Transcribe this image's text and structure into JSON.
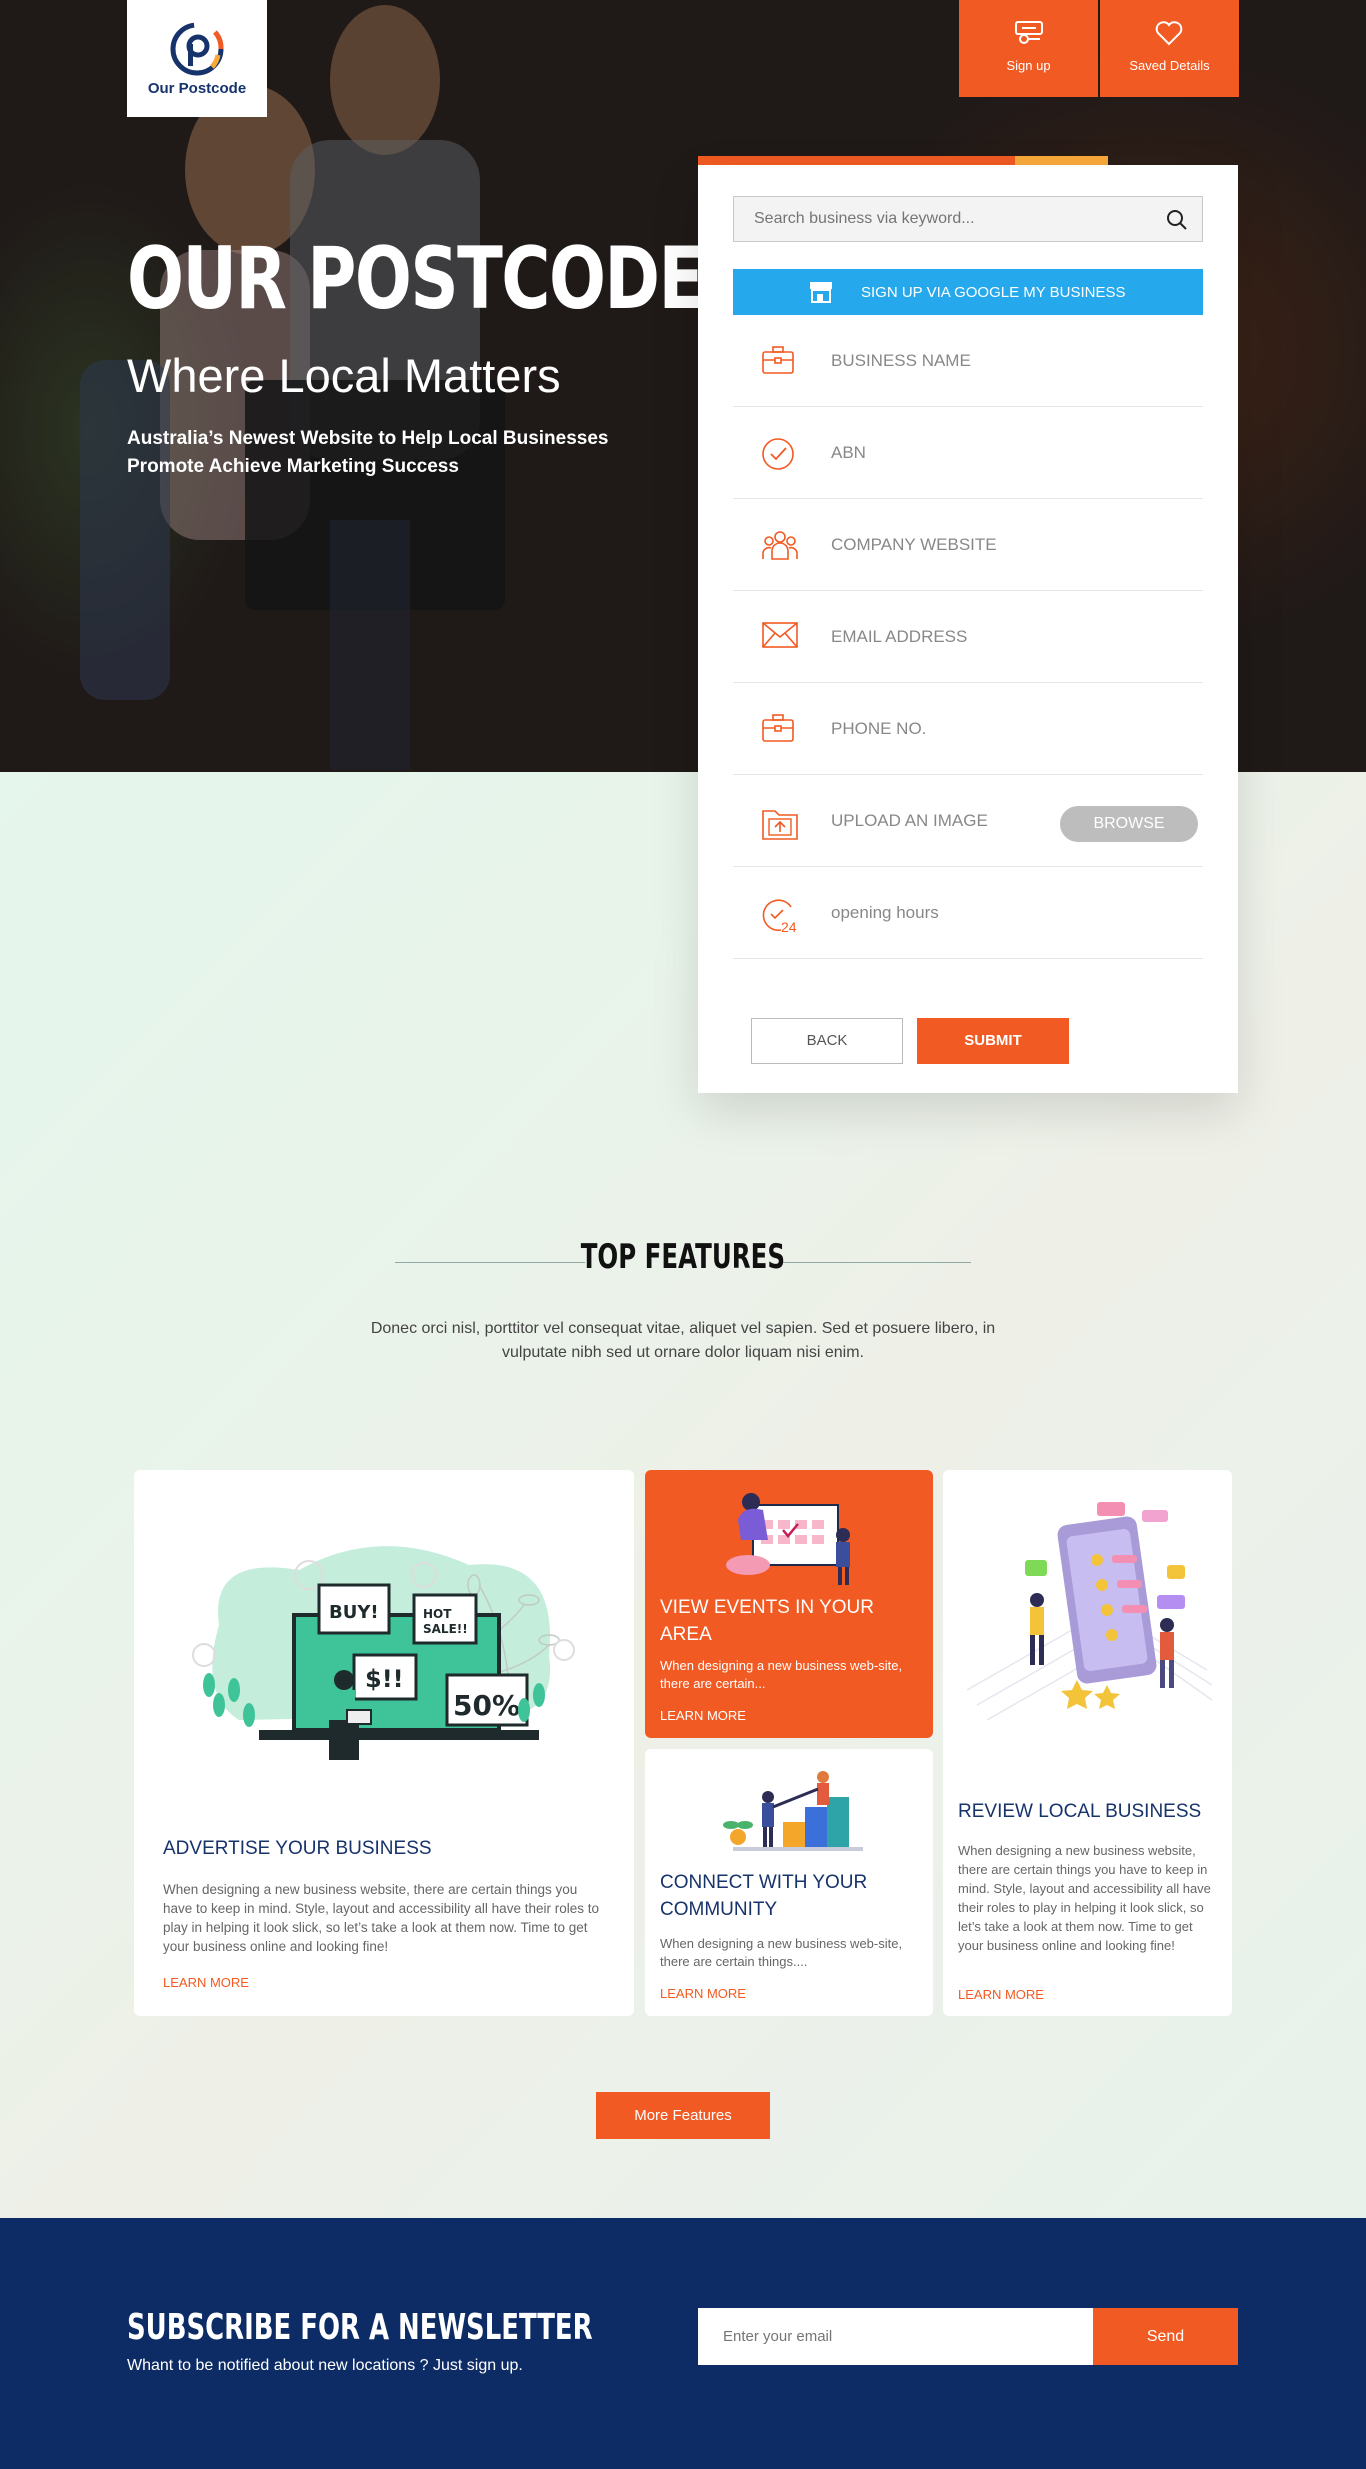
{
  "brand": {
    "logo_text": "Our Postcode"
  },
  "top_nav": {
    "signup_label": "Sign up",
    "saved_label": "Saved Details"
  },
  "hero": {
    "title": "OUR POSTCODE",
    "subtitle": "Where Local Matters",
    "description": "Australia’s Newest Website to Help Local Businesses Promote Achieve Marketing Success"
  },
  "form": {
    "search_placeholder": "Search business via keyword...",
    "google_label": "SIGN UP VIA GOOGLE MY BUSINESS",
    "fields": [
      {
        "label": "BUSINESS NAME",
        "icon": "briefcase-icon"
      },
      {
        "label": "ABN",
        "icon": "check-circle-icon"
      },
      {
        "label": "COMPANY WEBSITE",
        "icon": "team-icon"
      },
      {
        "label": "EMAIL ADDRESS",
        "icon": "envelope-icon"
      },
      {
        "label": "PHONE NO.",
        "icon": "briefcase-icon"
      },
      {
        "label": "UPLOAD AN IMAGE",
        "icon": "upload-folder-icon"
      },
      {
        "label": "opening hours",
        "icon": "clock-24-icon"
      }
    ],
    "browse_label": "BROWSE",
    "back_label": "BACK",
    "submit_label": "SUBMIT"
  },
  "features": {
    "title": "TOP FEATURES",
    "description": "Donec orci nisl, porttitor vel consequat vitae, aliquet vel sapien. Sed et posuere libero, in vulputate nibh sed ut ornare dolor liquam nisi enim.",
    "cards": [
      {
        "title": "ADVERTISE YOUR BUSINESS",
        "text": "When designing a new business website, there are certain things you have to keep in mind. Style, layout and accessibility all have their roles to play in helping it look slick, so let’s take a look at them now. Time to get your business online and looking fine!",
        "link": "LEARN MORE"
      },
      {
        "title": "VIEW EVENTS IN YOUR AREA",
        "text": "When designing a new business web-site, there are certain...",
        "link": "LEARN MORE"
      },
      {
        "title": "CONNECT WITH YOUR COMMUNITY",
        "text": "When designing a new business web-site, there are certain things....",
        "link": "LEARN MORE"
      },
      {
        "title": "REVIEW LOCAL BUSINESS",
        "text": "When designing a new business website, there are certain things you have to keep in mind. Style, layout and accessibility all have their roles to play in helping it look slick, so let’s take a look at them now. Time to get your business online and looking fine!",
        "link": "LEARN MORE"
      }
    ],
    "more_label": "More Features"
  },
  "newsletter": {
    "title": "SUBSCRIBE FOR A NEWSLETTER",
    "description": "Whant to be notified about new locations ? Just sign up.",
    "email_placeholder": "Enter your email",
    "send_label": "Send"
  },
  "colors": {
    "accent": "#f15a22",
    "navy": "#0d2c66",
    "google_blue": "#25a9ec",
    "highlight": "#f8a93a"
  }
}
